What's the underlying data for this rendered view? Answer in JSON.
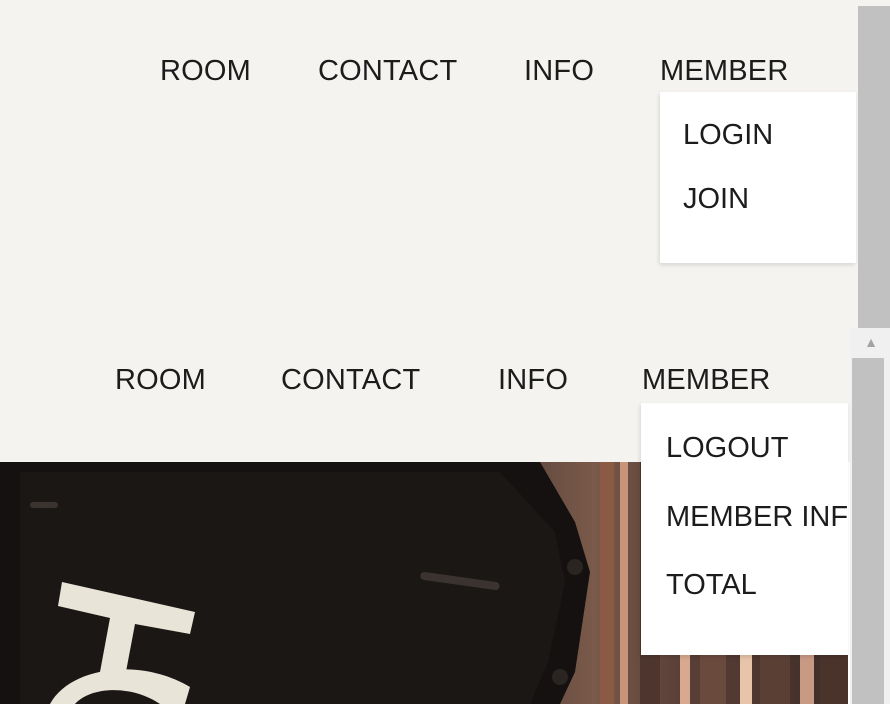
{
  "top_view": {
    "nav": {
      "room": "ROOM",
      "contact": "CONTACT",
      "info": "INFO",
      "member": "MEMBER"
    },
    "member_menu": [
      "LOGIN",
      "JOIN"
    ]
  },
  "bottom_view": {
    "nav": {
      "room": "ROOM",
      "contact": "CONTACT",
      "info": "INFO",
      "member": "MEMBER"
    },
    "member_menu": [
      "LOGOUT",
      "MEMBER INFO",
      "TOTAL"
    ],
    "scroll_up_glyph": "▲"
  },
  "colors": {
    "header_bg": "#f4f3ef",
    "scrollbar": "#c1c1c1",
    "text": "#1c1c1c"
  }
}
